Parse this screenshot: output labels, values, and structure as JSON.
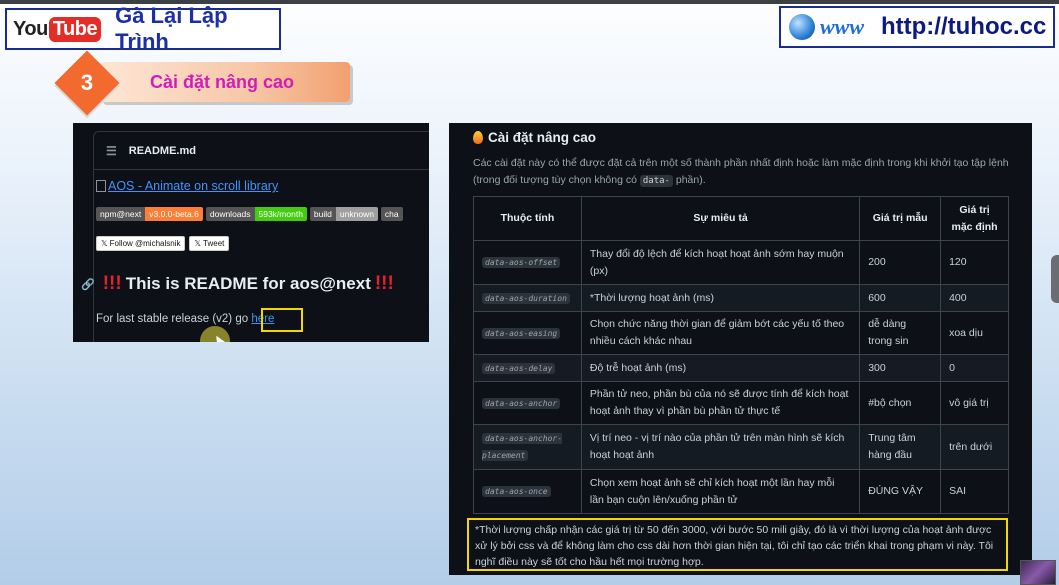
{
  "header": {
    "youtube_logo_you": "You",
    "youtube_logo_tube": "Tube",
    "channel_name": "Gà Lại Lập Trình",
    "www_logo": "www",
    "url": "http://tuhoc.cc"
  },
  "section": {
    "number": "3",
    "title": "Cài đặt nâng cao"
  },
  "readme": {
    "filename": "README.md",
    "aos_link": "AOS - Animate on scroll library",
    "badges": [
      {
        "label": "npm@next",
        "value": "v3.0.0-beta.6",
        "color": "#fe7d37"
      },
      {
        "label": "downloads",
        "value": "593k/month",
        "color": "#4c1"
      },
      {
        "label": "build",
        "value": "unknown",
        "color": "#9f9f9f"
      },
      {
        "label": "cha",
        "value": "",
        "color": "#555555"
      }
    ],
    "twitter_follow": "Follow @michalsnik",
    "twitter_tweet": "Tweet",
    "heading_bang": "!!!",
    "heading": "This is README for aos@next",
    "paragraph_prefix": "For last stable release (v2) go",
    "paragraph_link": "here"
  },
  "docs": {
    "title": "Cài đặt nâng cao",
    "description_1": "Các cài đặt này có thể được đặt cả trên một số thành phần nhất định hoặc làm mặc định trong khi khởi tạo tập lệnh (trong đối tượng tùy chọn không có",
    "description_code": "data-",
    "description_2": "phần).",
    "columns": [
      "Thuộc tính",
      "Sự miêu tả",
      "Giá trị mẫu",
      "Giá trị mặc định"
    ],
    "rows": [
      {
        "attr": "data-aos-offset",
        "desc": "Thay đổi độ lệch để kích hoạt hoạt ảnh sớm hay muộn (px)",
        "example": "200",
        "default": "120"
      },
      {
        "attr": "data-aos-duration",
        "desc": "*Thời lượng hoạt ảnh (ms)",
        "example": "600",
        "default": "400"
      },
      {
        "attr": "data-aos-easing",
        "desc": "Chọn chức năng thời gian để giảm bớt các yếu tố theo nhiều cách khác nhau",
        "example": "dễ dàng trong sin",
        "default": "xoa dịu"
      },
      {
        "attr": "data-aos-delay",
        "desc": "Độ trễ hoạt ảnh (ms)",
        "example": "300",
        "default": "0"
      },
      {
        "attr": "data-aos-anchor",
        "desc": "Phần tử neo, phần bù của nó sẽ được tính để kích hoạt hoạt ảnh thay vì phần bù phần tử thực tế",
        "example": "#bộ chọn",
        "default": "vô giá trị"
      },
      {
        "attr": "data-aos-anchor-placement",
        "desc": "Vị trí neo - vị trí nào của phần tử trên màn hình sẽ kích hoạt hoạt ảnh",
        "example": "Trung tâm hàng đầu",
        "default": "trên dưới"
      },
      {
        "attr": "data-aos-once",
        "desc": "Chọn xem hoạt ảnh sẽ chỉ kích hoạt một lần hay mỗi lần bạn cuộn lên/xuống phần tử",
        "example": "ĐÚNG VẬY",
        "default": "SAI"
      }
    ],
    "note": "*Thời lượng chấp nhận các giá trị từ 50 đến 3000, với bước 50 mili giây, đó là vì thời lượng của hoạt ảnh được xử lý bởi css và để không làm cho css dài hơn thời gian hiện tại, tôi chỉ tạo các triển khai trong phạm vi này. Tôi nghĩ điều này sẽ tốt cho hầu hết mọi trường hợp."
  }
}
